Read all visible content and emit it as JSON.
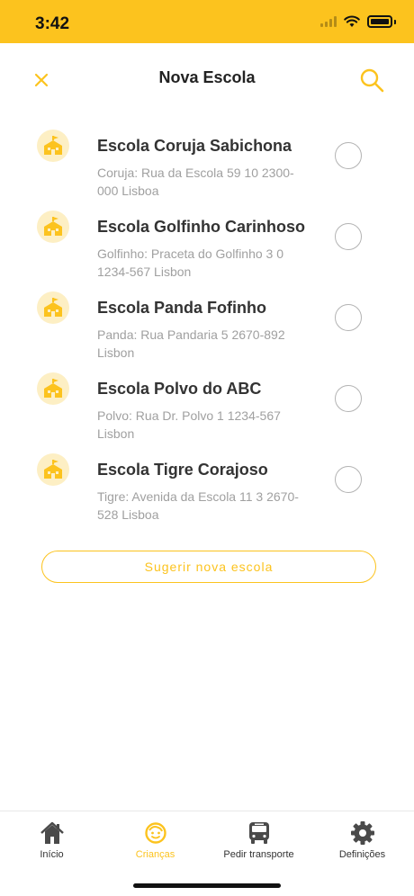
{
  "status_bar": {
    "time": "3:42"
  },
  "header": {
    "title": "Nova Escola",
    "close_icon": "close-icon",
    "search_icon": "search-icon"
  },
  "schools": [
    {
      "name": "Escola Coruja Sabichona",
      "address": "Coruja: Rua da Escola 59 10 2300-000 Lisboa",
      "selected": false
    },
    {
      "name": "Escola Golfinho Carinhoso",
      "address": "Golfinho: Praceta do Golfinho 3 0 1234-567 Lisbon",
      "selected": false
    },
    {
      "name": "Escola Panda Fofinho",
      "address": "Panda: Rua Pandaria 5 2670-892 Lisbon",
      "selected": false
    },
    {
      "name": "Escola Polvo do ABC",
      "address": "Polvo: Rua Dr. Polvo 1 1234-567 Lisbon",
      "selected": false
    },
    {
      "name": "Escola Tigre Corajoso",
      "address": "Tigre: Avenida da Escola 11 3 2670-528 Lisboa",
      "selected": false
    }
  ],
  "suggest_button": {
    "label": "Sugerir nova escola"
  },
  "tabs": [
    {
      "label": "Início",
      "icon": "home-icon",
      "active": false
    },
    {
      "label": "Crianças",
      "icon": "child-face-icon",
      "active": true
    },
    {
      "label": "Pedir transporte",
      "icon": "bus-icon",
      "active": false
    },
    {
      "label": "Definições",
      "icon": "gear-icon",
      "active": false
    }
  ],
  "colors": {
    "accent": "#fcc31e",
    "text": "#333333",
    "subtext": "#a0a0a0"
  }
}
